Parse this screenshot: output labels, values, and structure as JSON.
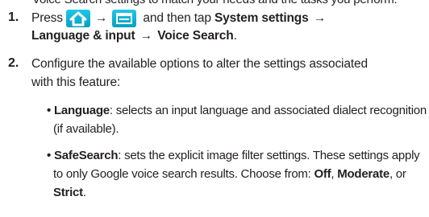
{
  "cut_off_text": "Voice Search settings to match your needs and the tasks you perform.",
  "steps": [
    {
      "number": "1.",
      "press": "Press",
      "arrow1": "→",
      "and_then_tap": "and then tap",
      "system_settings": "System settings",
      "arrow2": "→",
      "language_input": "Language & input",
      "arrow3": "→",
      "voice_search": "Voice Search",
      "end": "."
    },
    {
      "number": "2.",
      "line1": "Configure the available options to alter the settings associated",
      "line2": "with this feature:"
    }
  ],
  "bullets": [
    {
      "term": "Language",
      "line1_rest": ": selects an input language and associated dialect recognition",
      "line2": "(if available)."
    },
    {
      "term": "SafeSearch",
      "line1_rest": ": sets the explicit image filter settings. These settings apply",
      "line2_pre": "to only Google voice search results. Choose from: ",
      "opt_off": "Off",
      "sep1": ", ",
      "opt_moderate": "Moderate",
      "sep2": ", or",
      "opt_strict": "Strict",
      "end": "."
    }
  ],
  "icons": {
    "home_key": "home-icon",
    "menu_key": "menu-icon",
    "key_color": "#0fb4d6"
  }
}
